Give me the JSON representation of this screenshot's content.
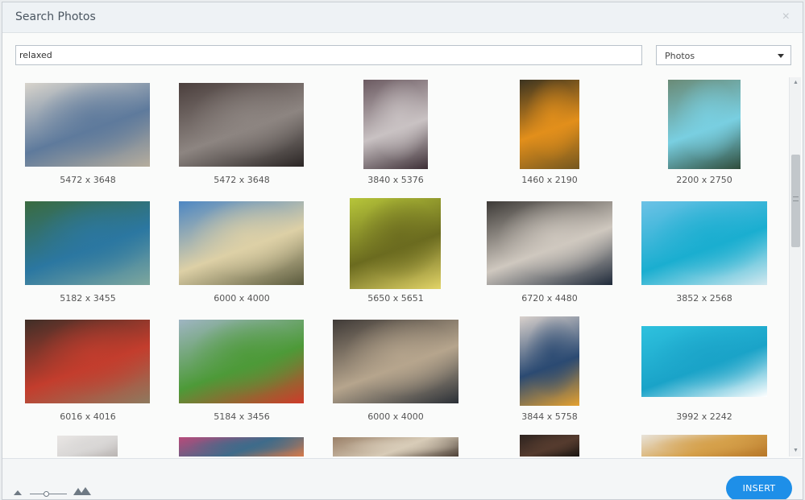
{
  "dialog": {
    "title": "Search Photos",
    "close_icon": "×"
  },
  "search": {
    "value": "relaxed",
    "placeholder": ""
  },
  "filter": {
    "selected": "Photos"
  },
  "photos": [
    {
      "caption": "5472 x 3648",
      "subject": "coffee-cup-flowers",
      "colors": [
        "#d8d4cc",
        "#5e7a9c",
        "#b6ad9d"
      ]
    },
    {
      "caption": "5472 x 3648",
      "subject": "woman-floating-water",
      "colors": [
        "#4b3f3d",
        "#8d8581",
        "#2b2625"
      ]
    },
    {
      "caption": "3840 x 5376",
      "subject": "person-holding-mug",
      "colors": [
        "#6b5a61",
        "#c9c2c3",
        "#3d2f36"
      ]
    },
    {
      "caption": "1460 x 2190",
      "subject": "woman-orange-shirt",
      "colors": [
        "#3b3320",
        "#e28f1b",
        "#74571f"
      ]
    },
    {
      "caption": "2200 x 2750",
      "subject": "person-in-hammock",
      "colors": [
        "#6a8a76",
        "#79cfe1",
        "#2f4c3b"
      ]
    },
    {
      "caption": "5182 x 3455",
      "subject": "infinity-pool-forest",
      "colors": [
        "#3a6b3f",
        "#2b77a1",
        "#7ea79e"
      ]
    },
    {
      "caption": "6000 x 4000",
      "subject": "man-on-bench-sunset",
      "colors": [
        "#4c86c3",
        "#ddd0a6",
        "#5a5a3d"
      ]
    },
    {
      "caption": "5650 x 5651",
      "subject": "large-tree-field",
      "colors": [
        "#b7c63a",
        "#6b6b1f",
        "#e2d468"
      ]
    },
    {
      "caption": "6720 x 4480",
      "subject": "reading-with-mug",
      "colors": [
        "#3d3a37",
        "#cfc8bf",
        "#1f2a3a"
      ]
    },
    {
      "caption": "3852 x 2568",
      "subject": "floating-turquoise-sea",
      "colors": [
        "#6cc2e6",
        "#1aaed0",
        "#d2e8ef"
      ]
    },
    {
      "caption": "6016 x 4016",
      "subject": "woman-by-window",
      "colors": [
        "#3f2f28",
        "#c33d2d",
        "#8e7a5f"
      ]
    },
    {
      "caption": "5184 x 3456",
      "subject": "person-blue-hat-meadow",
      "colors": [
        "#9fb5c3",
        "#4d9a38",
        "#d03a2a"
      ]
    },
    {
      "caption": "6000 x 4000",
      "subject": "coffee-letterboard-tray",
      "colors": [
        "#3f3a37",
        "#b6a58d",
        "#2a2f36"
      ]
    },
    {
      "caption": "3844 x 5758",
      "subject": "hands-holding-tea",
      "colors": [
        "#d9d1cc",
        "#2b4a72",
        "#e5a12f"
      ]
    },
    {
      "caption": "3992 x 2242",
      "subject": "boat-aerial-turquoise",
      "colors": [
        "#2ec1de",
        "#1aa3c8",
        "#ffffff"
      ]
    },
    {
      "caption": "",
      "subject": "light-room-partial",
      "colors": [
        "#e9e6e4",
        "#d9d7d6",
        "#b9b4b2"
      ]
    },
    {
      "caption": "",
      "subject": "colorful-hammock-partial",
      "colors": [
        "#b94a7a",
        "#3e6b8a",
        "#d77a4a"
      ]
    },
    {
      "caption": "",
      "subject": "interior-plant-partial",
      "colors": [
        "#9a8068",
        "#d8ccb8",
        "#4d4037"
      ]
    },
    {
      "caption": "",
      "subject": "dark-portrait-partial",
      "colors": [
        "#2d231f",
        "#553b2e",
        "#1a1512"
      ]
    },
    {
      "caption": "",
      "subject": "autumn-tree-partial",
      "colors": [
        "#e8e3da",
        "#d5a04a",
        "#b77728"
      ]
    }
  ],
  "footer": {
    "insert_label": "INSERT",
    "zoom": {
      "level": 0.45
    }
  },
  "scrollbar": {
    "position": 0.25,
    "up_icon": "▲",
    "down_icon": "▼"
  }
}
